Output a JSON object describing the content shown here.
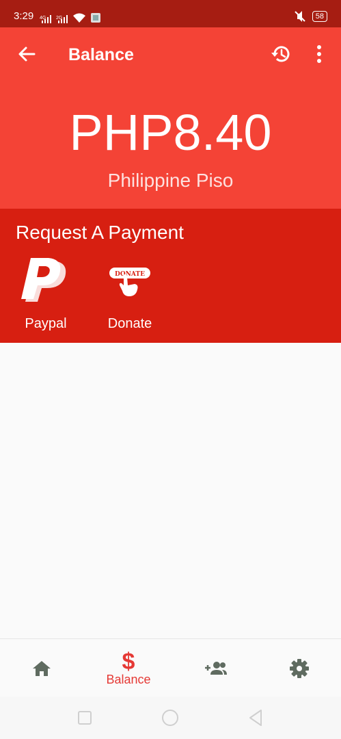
{
  "status_bar": {
    "time": "3:29",
    "battery": "58",
    "icons": [
      "signal-icon",
      "signal-icon",
      "wifi-icon",
      "notification-icon",
      "mute-icon",
      "battery-icon"
    ]
  },
  "app_bar": {
    "title": "Balance",
    "icons": [
      "back-arrow-icon",
      "history-icon",
      "more-vert-icon"
    ]
  },
  "balance": {
    "amount": "PHP8.40",
    "currency": "Philippine Piso"
  },
  "request": {
    "title": "Request A Payment",
    "options": [
      {
        "label": "Paypal",
        "icon": "paypal-icon"
      },
      {
        "label": "Donate",
        "icon": "donate-icon",
        "badge_text": "DONATE"
      }
    ]
  },
  "bottom_nav": {
    "items": [
      {
        "icon": "home-icon",
        "label": ""
      },
      {
        "icon": "dollar-icon",
        "label": "Balance",
        "symbol": "$",
        "active": true
      },
      {
        "icon": "add-user-icon",
        "label": ""
      },
      {
        "icon": "settings-icon",
        "label": ""
      }
    ]
  },
  "colors": {
    "status_bar": "#a61d12",
    "primary": "#f44336",
    "request_bg": "#d71f11",
    "active_nav": "#e53935",
    "inactive_nav": "#5f6b60"
  }
}
